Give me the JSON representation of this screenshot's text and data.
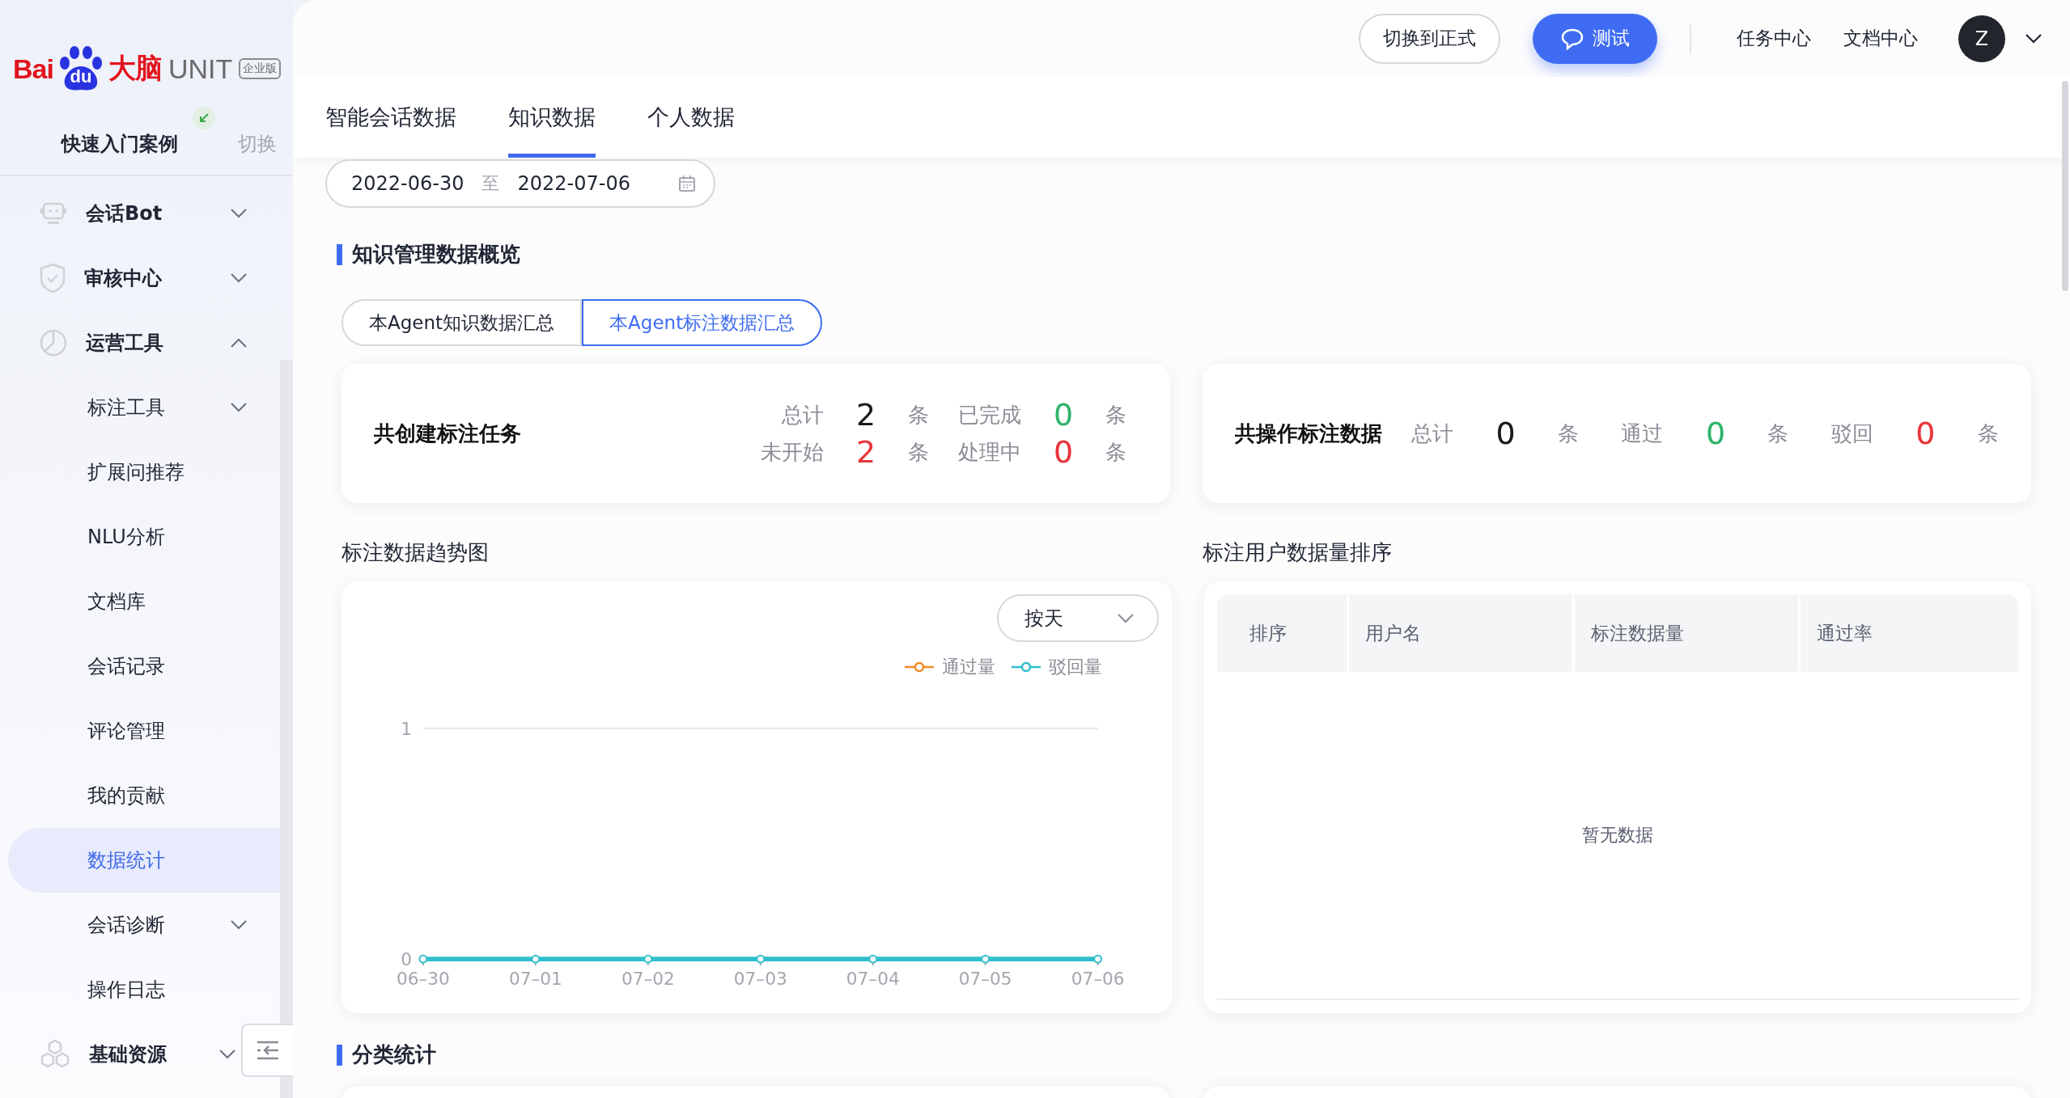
{
  "logo": {
    "bai": "Bai",
    "du": "du",
    "brain": "大脑",
    "product": "UNIT",
    "edition": "企业版"
  },
  "quick_start": {
    "label": "快速入门案例",
    "switch": "切换"
  },
  "sidebar": {
    "items": [
      {
        "label": "会话Bot",
        "expanded": false,
        "selected": false
      },
      {
        "label": "审核中心",
        "expanded": false,
        "selected": false
      },
      {
        "label": "运营工具",
        "expanded": true,
        "selected": false,
        "children": [
          {
            "label": "标注工具",
            "expanded": false,
            "selected": false
          },
          {
            "label": "扩展问推荐",
            "selected": false
          },
          {
            "label": "NLU分析",
            "selected": false
          },
          {
            "label": "文档库",
            "selected": false
          },
          {
            "label": "会话记录",
            "selected": false
          },
          {
            "label": "评论管理",
            "selected": false
          },
          {
            "label": "我的贡献",
            "selected": false
          },
          {
            "label": "数据统计",
            "selected": true
          },
          {
            "label": "会话诊断",
            "expanded": false,
            "selected": false
          },
          {
            "label": "操作日志",
            "selected": false
          }
        ]
      },
      {
        "label": "基础资源",
        "expanded": false,
        "selected": false
      }
    ]
  },
  "topbar": {
    "switch_button": "切换到正式",
    "test_button": "测试",
    "links": [
      "任务中心",
      "文档中心"
    ],
    "avatar": "Z"
  },
  "tabs": [
    {
      "label": "智能会话数据",
      "selected": false
    },
    {
      "label": "知识数据",
      "selected": true
    },
    {
      "label": "个人数据",
      "selected": false
    }
  ],
  "date_range": {
    "start": "2022-06-30",
    "separator": "至",
    "end": "2022-07-06"
  },
  "overview_title": "知识管理数据概览",
  "segments": [
    {
      "label": "本Agent知识数据汇总",
      "selected": false
    },
    {
      "label": "本Agent标注数据汇总",
      "selected": true
    }
  ],
  "task_card": {
    "title": "共创建标注任务",
    "stats": [
      {
        "label": "总计",
        "value": "2",
        "unit": "条",
        "color": "#1a1a1a"
      },
      {
        "label": "已完成",
        "value": "0",
        "unit": "条",
        "color": "#2fb36a"
      },
      {
        "label": "未开始",
        "value": "2",
        "unit": "条",
        "color": "#e8343a"
      },
      {
        "label": "处理中",
        "value": "0",
        "unit": "条",
        "color": "#e8343a"
      }
    ]
  },
  "ops_card": {
    "title": "共操作标注数据",
    "stats": [
      {
        "label": "总计",
        "value": "0",
        "unit": "条",
        "color": "#1a1a1a"
      },
      {
        "label": "通过",
        "value": "0",
        "unit": "条",
        "color": "#2fb36a"
      },
      {
        "label": "驳回",
        "value": "0",
        "unit": "条",
        "color": "#e8343a"
      }
    ]
  },
  "trend": {
    "title": "标注数据趋势图",
    "granularity": "按天",
    "chart_data": {
      "type": "line",
      "categories": [
        "06–30",
        "07–01",
        "07–02",
        "07–03",
        "07–04",
        "07–05",
        "07–06"
      ],
      "ylim": [
        0,
        1
      ],
      "yticks": [
        0,
        1
      ],
      "series": [
        {
          "name": "通过量",
          "color": "#f08a24",
          "marker": "circle",
          "values": [
            null,
            null,
            null,
            null,
            null,
            null,
            null
          ]
        },
        {
          "name": "驳回量",
          "color": "#2fbfcc",
          "marker": "circle",
          "values": [
            0,
            0,
            0,
            0,
            0,
            0,
            0
          ]
        }
      ]
    }
  },
  "ranking": {
    "title": "标注用户数据量排序",
    "columns": [
      "排序",
      "用户名",
      "标注数据量",
      "通过率"
    ],
    "empty": "暂无数据"
  },
  "category_title": "分类统计"
}
